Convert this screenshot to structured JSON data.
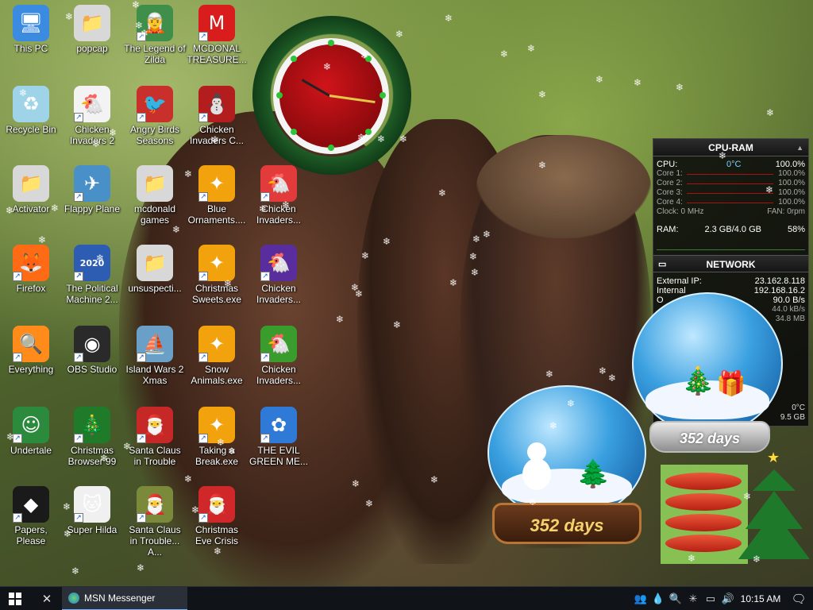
{
  "desktop": {
    "icons": [
      {
        "label": "This PC",
        "icon": "computer-icon",
        "color": "#3b8be0",
        "glyph": "🖥",
        "shortcut": false
      },
      {
        "label": "popcap",
        "icon": "folder-icon",
        "color": "#d8d8d8",
        "glyph": "📁",
        "shortcut": false
      },
      {
        "label": "The Legend of Zilda",
        "icon": "game-character-icon",
        "color": "#3f8f4a",
        "glyph": "🧝",
        "shortcut": true
      },
      {
        "label": "MCDONAL TREASURE...",
        "icon": "mcdonalds-logo-icon",
        "color": "#d91c1c",
        "glyph": "M",
        "shortcut": true
      },
      {
        "label": "Recycle Bin",
        "icon": "recycle-bin-icon",
        "color": "#9fd4e8",
        "glyph": "♻",
        "shortcut": false
      },
      {
        "label": "Chicken Invaders 2",
        "icon": "chicken-icon",
        "color": "#f3f3f3",
        "glyph": "🐔",
        "shortcut": true
      },
      {
        "label": "Angry Birds Seasons",
        "icon": "angry-bird-icon",
        "color": "#c9302c",
        "glyph": "🐦",
        "shortcut": true
      },
      {
        "label": "Chicken Invaders C...",
        "icon": "chicken-snowman-icon",
        "color": "#b31d1d",
        "glyph": "⛄",
        "shortcut": true
      },
      {
        "label": "Activator",
        "icon": "folder-icon",
        "color": "#d8d8d8",
        "glyph": "📁",
        "shortcut": false
      },
      {
        "label": "Flappy Plane",
        "icon": "plane-game-icon",
        "color": "#4a90c8",
        "glyph": "✈",
        "shortcut": true
      },
      {
        "label": "mcdonald games",
        "icon": "folder-icon",
        "color": "#d8d8d8",
        "glyph": "📁",
        "shortcut": false
      },
      {
        "label": "Blue Ornaments....",
        "icon": "installer-icon",
        "color": "#f2a20c",
        "glyph": "✦",
        "shortcut": true
      },
      {
        "label": "Chicken Invaders...",
        "icon": "chicken-icon",
        "color": "#e33b3b",
        "glyph": "🐔",
        "shortcut": true
      },
      {
        "label": "Firefox",
        "icon": "firefox-icon",
        "color": "#ff6a14",
        "glyph": "🦊",
        "shortcut": true
      },
      {
        "label": "The Political Machine 2...",
        "icon": "political-machine-icon",
        "color": "#2d5db3",
        "glyph": "2020",
        "shortcut": true
      },
      {
        "label": "unsuspecti...",
        "icon": "folder-icon",
        "color": "#d8d8d8",
        "glyph": "📁",
        "shortcut": false
      },
      {
        "label": "Christmas Sweets.exe",
        "icon": "installer-icon",
        "color": "#f2a20c",
        "glyph": "✦",
        "shortcut": true
      },
      {
        "label": "Chicken Invaders...",
        "icon": "chicken-icon",
        "color": "#5a2d9e",
        "glyph": "🐔",
        "shortcut": true
      },
      {
        "label": "Everything",
        "icon": "magnifier-icon",
        "color": "#ff8c1a",
        "glyph": "🔍",
        "shortcut": true
      },
      {
        "label": "OBS Studio",
        "icon": "obs-icon",
        "color": "#2a2a2a",
        "glyph": "◉",
        "shortcut": true
      },
      {
        "label": "Island Wars 2 Xmas",
        "icon": "island-wars-icon",
        "color": "#6aa0c8",
        "glyph": "⛵",
        "shortcut": true
      },
      {
        "label": "Snow Animals.exe",
        "icon": "installer-icon",
        "color": "#f2a20c",
        "glyph": "✦",
        "shortcut": true
      },
      {
        "label": "Chicken Invaders...",
        "icon": "chicken-icon",
        "color": "#3b9c2e",
        "glyph": "🐔",
        "shortcut": true
      },
      {
        "label": "Undertale",
        "icon": "undertale-icon",
        "color": "#2c8a3c",
        "glyph": "☺",
        "shortcut": true
      },
      {
        "label": "Christmas Browser 99",
        "icon": "christmas-tree-icon",
        "color": "#1f7a2a",
        "glyph": "🎄",
        "shortcut": true
      },
      {
        "label": "Santa Claus in Trouble",
        "icon": "santa-icon",
        "color": "#c62828",
        "glyph": "🎅",
        "shortcut": true
      },
      {
        "label": "Taking a Break.exe",
        "icon": "installer-icon",
        "color": "#f2a20c",
        "glyph": "✦",
        "shortcut": true
      },
      {
        "label": "THE EVIL GREEN ME...",
        "icon": "msn-butterfly-icon",
        "color": "#2f7ad6",
        "glyph": "✿",
        "shortcut": true
      },
      {
        "label": "Papers, Please",
        "icon": "papers-please-icon",
        "color": "#1a1a1a",
        "glyph": "◆",
        "shortcut": true
      },
      {
        "label": "Super Hilda",
        "icon": "hilda-icon",
        "color": "#f0f0f0",
        "glyph": "🐱",
        "shortcut": true
      },
      {
        "label": "Santa Claus in Trouble... A...",
        "icon": "santa-icon",
        "color": "#7a8a3a",
        "glyph": "🎅",
        "shortcut": true
      },
      {
        "label": "Christmas Eve Crisis",
        "icon": "santa-icon",
        "color": "#d0282a",
        "glyph": "🎅",
        "shortcut": true
      }
    ]
  },
  "cpu_ram": {
    "title": "CPU-RAM",
    "cpu_label": "CPU:",
    "cpu_temp": "0°C",
    "cpu_value": "100.0%",
    "cores": [
      {
        "label": "Core 1:",
        "value": "100.0%"
      },
      {
        "label": "Core 2:",
        "value": "100.0%"
      },
      {
        "label": "Core 3:",
        "value": "100.0%"
      },
      {
        "label": "Core 4:",
        "value": "100.0%"
      }
    ],
    "clock": "Clock: 0 MHz",
    "fan": "FAN: 0rpm",
    "ram_label": "RAM:",
    "ram_used": "2.3 GB/4.0 GB",
    "ram_pct": "58%"
  },
  "network": {
    "title": "NETWORK",
    "external_label": "External IP:",
    "external_ip": "23.162.8.118",
    "internal_label": "Internal",
    "internal_ip": "192.168.16.2",
    "row3_label": "O",
    "row3_value": "90.0 B/s",
    "row4_value": "44.0 kB/s",
    "row5_value": "34.8 MB",
    "temp": "0°C",
    "size": "9.5 GB"
  },
  "globes": {
    "large_days": "352 days",
    "small_days": "352 days"
  },
  "taskbar": {
    "app_label": "MSN Messenger",
    "clock": "10:15 AM"
  },
  "colors": {
    "taskbar_bg": "#101318",
    "accent": "#77b4ff"
  }
}
